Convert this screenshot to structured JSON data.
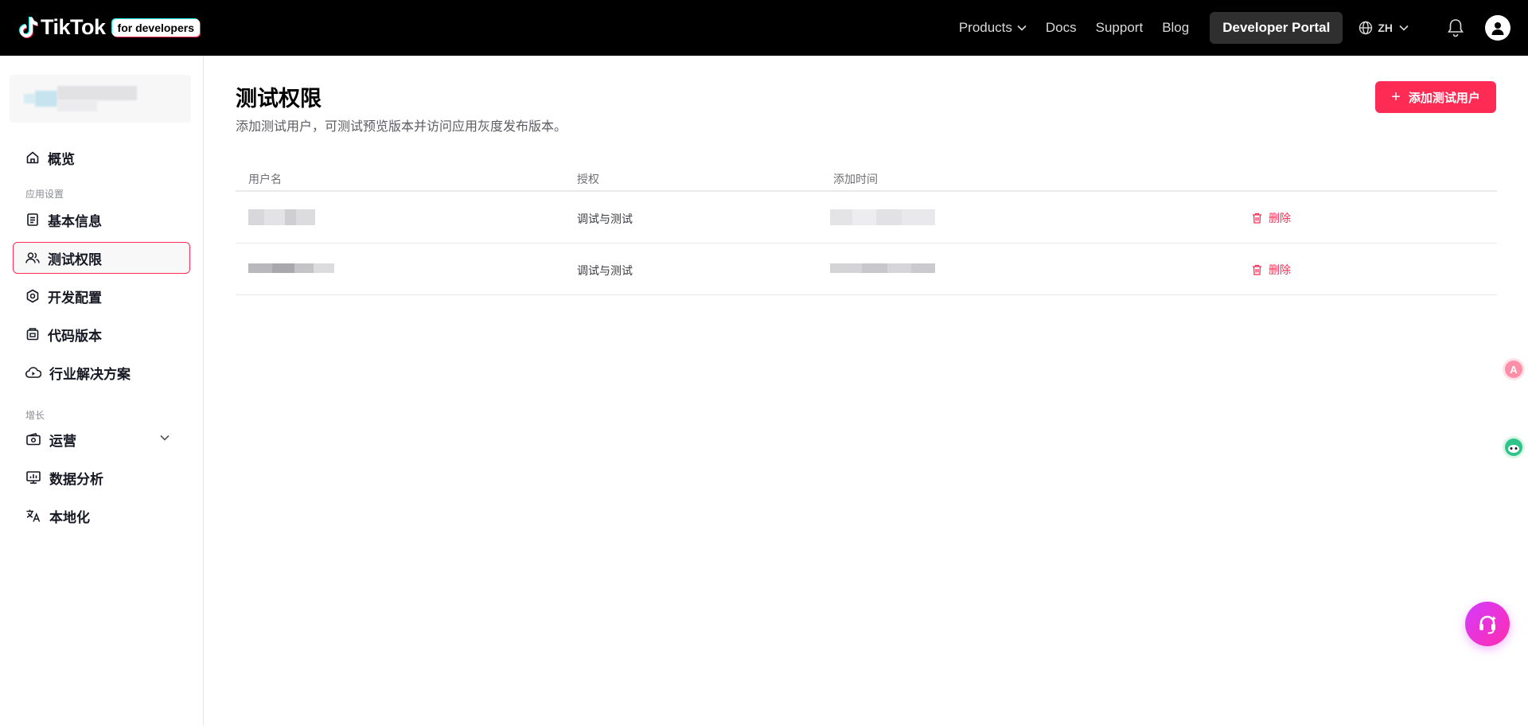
{
  "topnav": {
    "logo_text": "TikTok",
    "logo_badge": "for developers",
    "links": {
      "products": "Products",
      "docs": "Docs",
      "support": "Support",
      "blog": "Blog"
    },
    "portal_button": "Developer Portal",
    "language": "ZH"
  },
  "sidebar": {
    "overview": "概览",
    "section_app_settings": "应用设置",
    "basic_info": "基本信息",
    "test_permissions": "测试权限",
    "dev_config": "开发配置",
    "code_version": "代码版本",
    "industry_solutions": "行业解决方案",
    "section_growth": "增长",
    "operations": "运营",
    "data_analysis": "数据分析",
    "localization": "本地化"
  },
  "main": {
    "title": "测试权限",
    "subtitle": "添加测试用户，可测试预览版本并访问应用灰度发布版本。",
    "add_button": "添加测试用户",
    "columns": {
      "username": "用户名",
      "auth": "授权",
      "added_time": "添加时间"
    },
    "rows": [
      {
        "auth": "调试与测试",
        "delete": "删除"
      },
      {
        "auth": "调试与测试",
        "delete": "删除"
      }
    ]
  },
  "colors": {
    "brand": "#fe2c55",
    "nav_bg": "#000000",
    "help_gradient": "#d43bff"
  }
}
